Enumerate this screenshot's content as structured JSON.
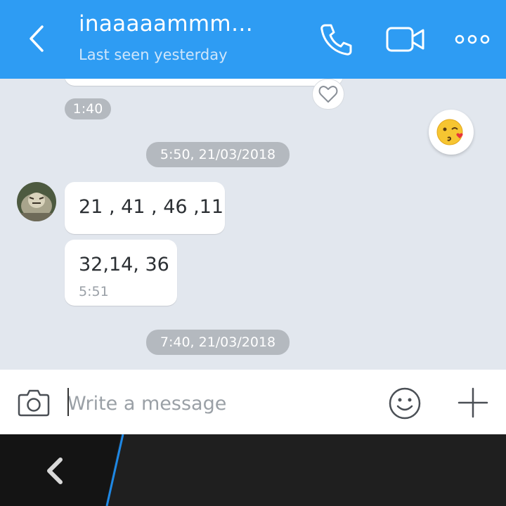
{
  "header": {
    "title": "inaaaaammm…",
    "subtitle": "Last seen yesterday"
  },
  "chat": {
    "first_time": "1:40",
    "date_separator_1": "5:50, 21/03/2018",
    "date_separator_2": "7:40, 21/03/2018",
    "messages": [
      {
        "text": "21 , 41 , 46 ,11"
      },
      {
        "text": "32,14, 36",
        "time": "5:51"
      }
    ]
  },
  "composer": {
    "placeholder": "Write a message"
  },
  "colors": {
    "header": "#2e9cf3",
    "chat_bg": "#e2e7ee",
    "pill": "#b4b9bf",
    "navbar": "#1f1f1f",
    "nav_accent": "#1e88e5"
  },
  "icons": [
    "back-arrow-icon",
    "phone-icon",
    "video-camera-icon",
    "more-dots-icon",
    "heart-icon",
    "kiss-emoji-icon",
    "camera-icon",
    "smiley-icon",
    "plus-icon",
    "nav-back-icon"
  ]
}
